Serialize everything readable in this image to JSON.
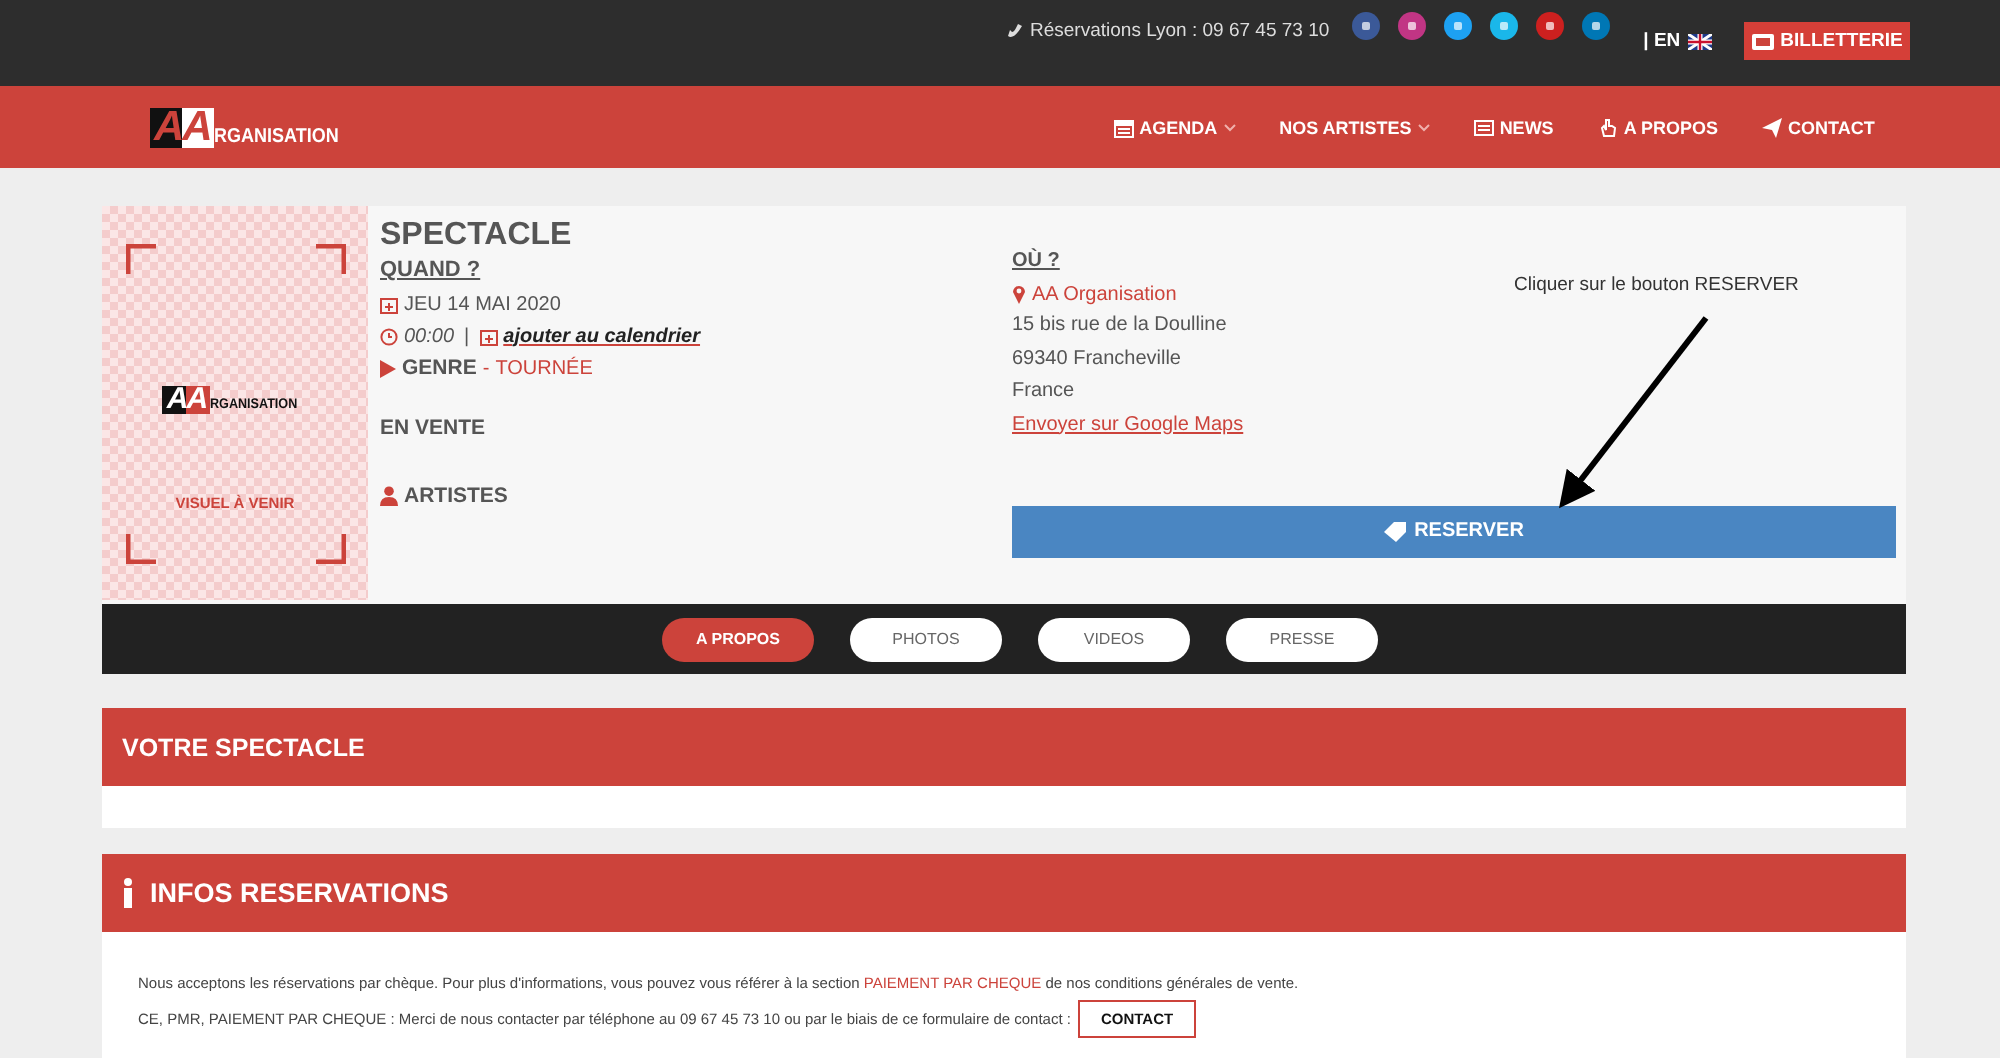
{
  "topbar": {
    "phone": "Réservations Lyon : 09 67 45 73 10",
    "social": [
      {
        "color": "#3b5998"
      },
      {
        "color": "#c13584"
      },
      {
        "color": "#1da1f2"
      },
      {
        "color": "#1ab7ea"
      },
      {
        "color": "#cd201f"
      },
      {
        "color": "#0077b5"
      }
    ],
    "language": "| EN",
    "ticket_button": "BILLETTERIE"
  },
  "nav": {
    "logo": {
      "letters": "AA",
      "word": "RGANISATION"
    },
    "items": [
      {
        "label": "AGENDA",
        "dropdown": true
      },
      {
        "label": "NOS ARTISTES",
        "dropdown": true
      },
      {
        "label": "NEWS",
        "dropdown": false
      },
      {
        "label": "A PROPOS",
        "dropdown": false
      },
      {
        "label": "CONTACT",
        "dropdown": false
      }
    ]
  },
  "event": {
    "poster": {
      "logo_letters": "AA",
      "logo_word": "RGANISATION",
      "caption": "VISUEL À VENIR"
    },
    "title": "SPECTACLE",
    "when_label": "QUAND ?",
    "date": "JEU 14 MAI 2020",
    "time": "00:00",
    "separator": "|",
    "calendar_link": "ajouter au calendrier",
    "genre_label": "GENRE",
    "genre_dash": "-",
    "genre": "TOURNÉE",
    "sale_status": "EN VENTE",
    "artists_label": "ARTISTES",
    "where_label": "OÙ ?",
    "venue": "AA Organisation",
    "address": [
      "15 bis rue de la Doulline",
      "69340 Francheville",
      "France"
    ],
    "maps_link": "Envoyer sur Google Maps",
    "reserve_button": "RESERVER",
    "annotation": "Cliquer sur le bouton RESERVER"
  },
  "tabs": [
    {
      "label": "A PROPOS",
      "selected": true
    },
    {
      "label": "PHOTOS",
      "selected": false
    },
    {
      "label": "VIDEOS",
      "selected": false
    },
    {
      "label": "PRESSE",
      "selected": false
    }
  ],
  "sections": [
    {
      "title": "VOTRE SPECTACLE"
    },
    {
      "title": "INFOS RESERVATIONS",
      "paragraph": "Nous acceptons les réservations par chèque. Pour plus d'informations, vous pouvez vous référer à la section",
      "link": "PAIEMENT PAR CHEQUE",
      "paragraph_end": "de nos conditions générales de vente.",
      "contact_text": "CE, PMR, PAIEMENT PAR CHEQUE : Merci de nous contacter par téléphone au 09 67 45 73 10 ou par le biais de ce formulaire de contact :",
      "contact_button": "CONTACT"
    }
  ]
}
